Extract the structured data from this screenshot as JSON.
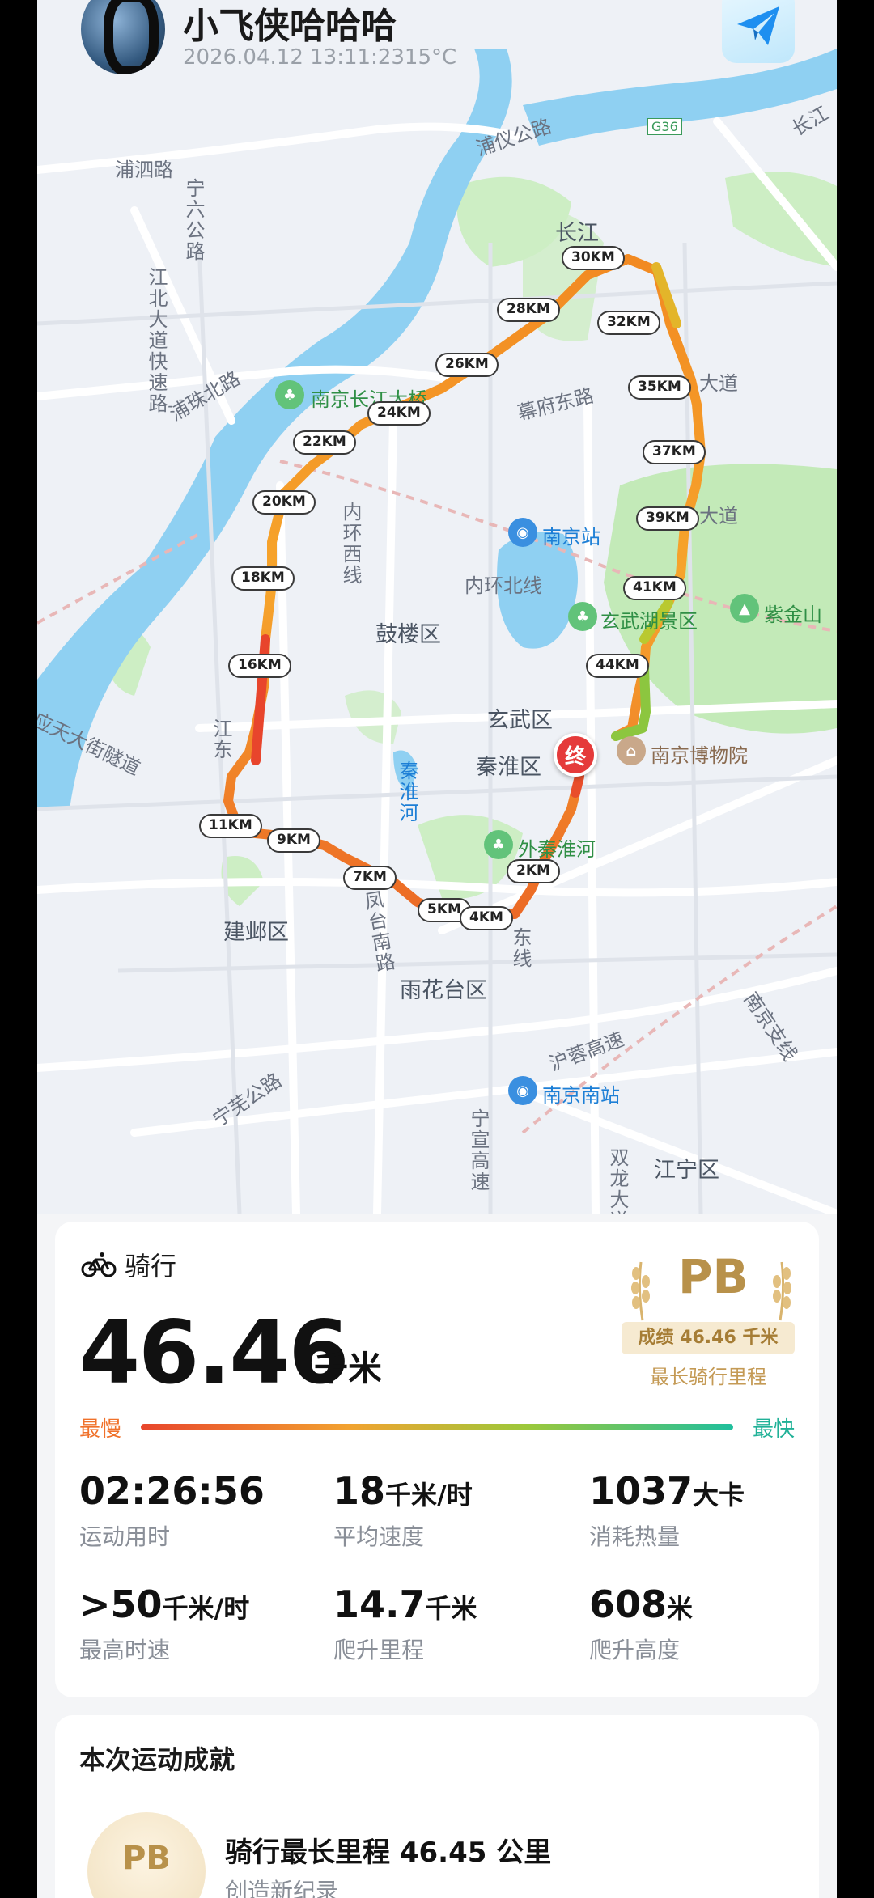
{
  "header": {
    "user_name": "小飞侠哈哈哈",
    "meta": "2026.04.12 13:11:2315°C",
    "share_icon": "paper-plane-icon"
  },
  "map": {
    "labels": {
      "puyi_road": "浦仪公路",
      "pusi_road": "浦泗路",
      "ningliu_road": "宁六公路",
      "jiangbei_expressway": "江北大道快速路",
      "puzhu_north": "浦珠北路",
      "bridge_poi": "南京长江大桥",
      "yangtze": "长江",
      "yangtze_top": "长江",
      "g36": "G36",
      "mufu_east": "幕府东路",
      "avenue_1": "大道",
      "avenue_2": "大道",
      "inner_ring_west": "内环西线",
      "inner_ring_north": "内环北线",
      "nanjing_station": "南京站",
      "gulou": "鼓楼区",
      "xuanwu": "玄武区",
      "qinhuai": "秦淮区",
      "xuanwu_lake": "玄武湖景区",
      "zijinshan": "紫金山",
      "museum": "南京博物院",
      "qinhuai_river": "秦淮河",
      "waiqinhuai": "外秦淮河",
      "yingtian_tunnel": "应天大街隧道",
      "jiangdong": "江东",
      "jianye": "建邺区",
      "fengtai_south": "凤台南路",
      "east_line": "东线",
      "yuhuatai": "雨花台区",
      "huning_expressway": "沪蓉高速",
      "nanjing_south": "南京南站",
      "ningwu_road": "宁芜公路",
      "ningxuan_expressway": "宁宣高速",
      "shuanglong": "双龙大道",
      "jiangning": "江宁区",
      "nanjing_branch": "南京支线"
    },
    "km_markers": [
      "30KM",
      "32KM",
      "28KM",
      "26KM",
      "35KM",
      "24KM",
      "22KM",
      "37KM",
      "20KM",
      "39KM",
      "18KM",
      "41KM",
      "16KM",
      "44KM",
      "11KM",
      "9KM",
      "7KM",
      "2KM",
      "5KM",
      "4KM"
    ],
    "end_marker": "终"
  },
  "stats": {
    "activity_type": "骑行",
    "activity_icon": "bicycle-icon",
    "distance_value": "46.46",
    "distance_unit": "千米",
    "pb_label": "PB",
    "pb_badge": "成绩 46.46 千米",
    "pb_subtitle": "最长骑行里程",
    "speed_slow": "最慢",
    "speed_fast": "最快",
    "items": [
      {
        "value": "02:26:56",
        "unit": "",
        "label": "运动用时"
      },
      {
        "value": "18",
        "unit": "千米/时",
        "label": "平均速度"
      },
      {
        "value": "1037",
        "unit": "大卡",
        "label": "消耗热量"
      },
      {
        "value": ">50",
        "unit": "千米/时",
        "label": "最高时速"
      },
      {
        "value": "14.7",
        "unit": "千米",
        "label": "爬升里程"
      },
      {
        "value": "608",
        "unit": "米",
        "label": "爬升高度"
      }
    ]
  },
  "achievements": {
    "title": "本次运动成就",
    "items": [
      {
        "badge": "PB",
        "name": "骑行最长里程 46.45 公里",
        "desc": "创造新纪录"
      }
    ]
  },
  "colors": {
    "route_slow": "#e8452c",
    "route_mid": "#f2a230",
    "route_fast": "#8cc63f",
    "water": "#8fd0f2",
    "park": "#c8ecc0",
    "pb_gold": "#b8914a"
  }
}
